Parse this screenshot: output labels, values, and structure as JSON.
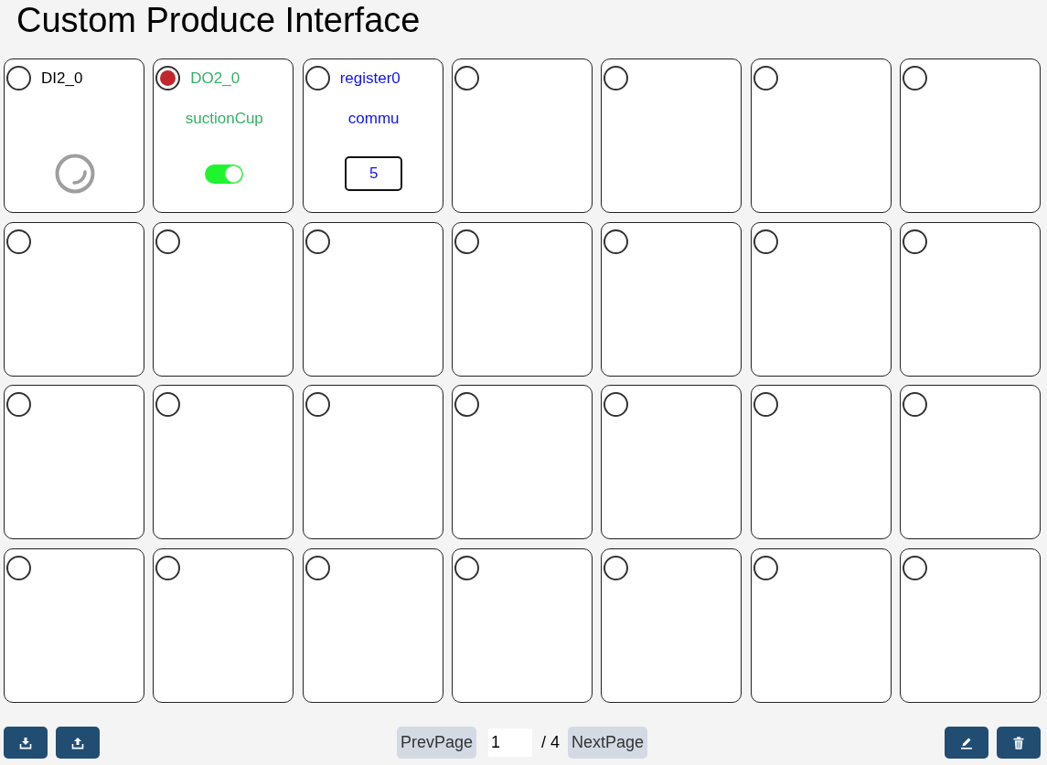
{
  "title": "Custom Produce Interface",
  "cards": [
    {
      "kind": "di",
      "selected": false,
      "name": "DI2_0",
      "on": false
    },
    {
      "kind": "do",
      "selected": true,
      "name": "DO2_0",
      "label": "suctionCup",
      "on": true
    },
    {
      "kind": "register",
      "selected": false,
      "name": "register0",
      "label": "commu",
      "value": "5"
    },
    {
      "kind": "empty",
      "selected": false
    },
    {
      "kind": "empty",
      "selected": false
    },
    {
      "kind": "empty",
      "selected": false
    },
    {
      "kind": "empty",
      "selected": false
    },
    {
      "kind": "empty",
      "selected": false
    },
    {
      "kind": "empty",
      "selected": false
    },
    {
      "kind": "empty",
      "selected": false
    },
    {
      "kind": "empty",
      "selected": false
    },
    {
      "kind": "empty",
      "selected": false
    },
    {
      "kind": "empty",
      "selected": false
    },
    {
      "kind": "empty",
      "selected": false
    },
    {
      "kind": "empty",
      "selected": false
    },
    {
      "kind": "empty",
      "selected": false
    },
    {
      "kind": "empty",
      "selected": false
    },
    {
      "kind": "empty",
      "selected": false
    },
    {
      "kind": "empty",
      "selected": false
    },
    {
      "kind": "empty",
      "selected": false
    },
    {
      "kind": "empty",
      "selected": false
    },
    {
      "kind": "empty",
      "selected": false
    },
    {
      "kind": "empty",
      "selected": false
    },
    {
      "kind": "empty",
      "selected": false
    },
    {
      "kind": "empty",
      "selected": false
    },
    {
      "kind": "empty",
      "selected": false
    },
    {
      "kind": "empty",
      "selected": false
    },
    {
      "kind": "empty",
      "selected": false
    }
  ],
  "pagination": {
    "prev": "PrevPage",
    "page": "1",
    "total": "/ 4",
    "next": "NextPage"
  }
}
